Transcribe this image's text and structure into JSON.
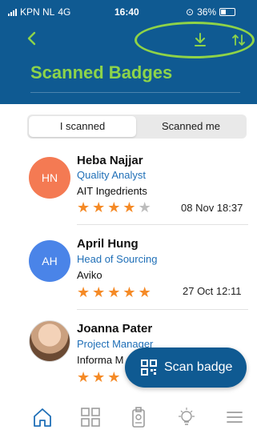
{
  "status_bar": {
    "carrier": "KPN NL",
    "network": "4G",
    "time": "16:40",
    "battery": "36%"
  },
  "header": {
    "back_icon": "chevron-left-icon",
    "title": "Scanned Badges",
    "download_icon": "download-icon",
    "sort_icon": "sort-arrows-icon",
    "colors": {
      "background": "#0f5a92",
      "accent": "#8dd44a"
    }
  },
  "tabs": [
    {
      "label": "I scanned",
      "active": true
    },
    {
      "label": "Scanned me",
      "active": false
    }
  ],
  "contacts": [
    {
      "initials": "HN",
      "avatar_color": "#f47a53",
      "name": "Heba Najjar",
      "role": "Quality Analyst",
      "company": "AIT Ingedrients",
      "rating": 4,
      "date": "08 Nov 18:37"
    },
    {
      "initials": "AH",
      "avatar_color": "#4a84e8",
      "name": "April Hung",
      "role": "Head of Sourcing",
      "company": "Aviko",
      "rating": 5,
      "date": "27 Oct 12:11"
    },
    {
      "initials": "",
      "avatar_color": "#b98f6c",
      "name": "Joanna Pater",
      "role": "Project Manager",
      "company": "Informa M",
      "rating": 3,
      "date": ""
    }
  ],
  "fab": {
    "label": "Scan badge",
    "icon": "qr-code-icon"
  },
  "bottom_nav": {
    "items": [
      {
        "icon": "home-icon",
        "active": true
      },
      {
        "icon": "qr-grid-icon",
        "active": false
      },
      {
        "icon": "badge-icon",
        "active": false
      },
      {
        "icon": "lightbulb-icon",
        "active": false
      },
      {
        "icon": "menu-icon",
        "active": false
      }
    ],
    "colors": {
      "active": "#1f6fb7",
      "inactive": "#9c9c9c"
    }
  }
}
